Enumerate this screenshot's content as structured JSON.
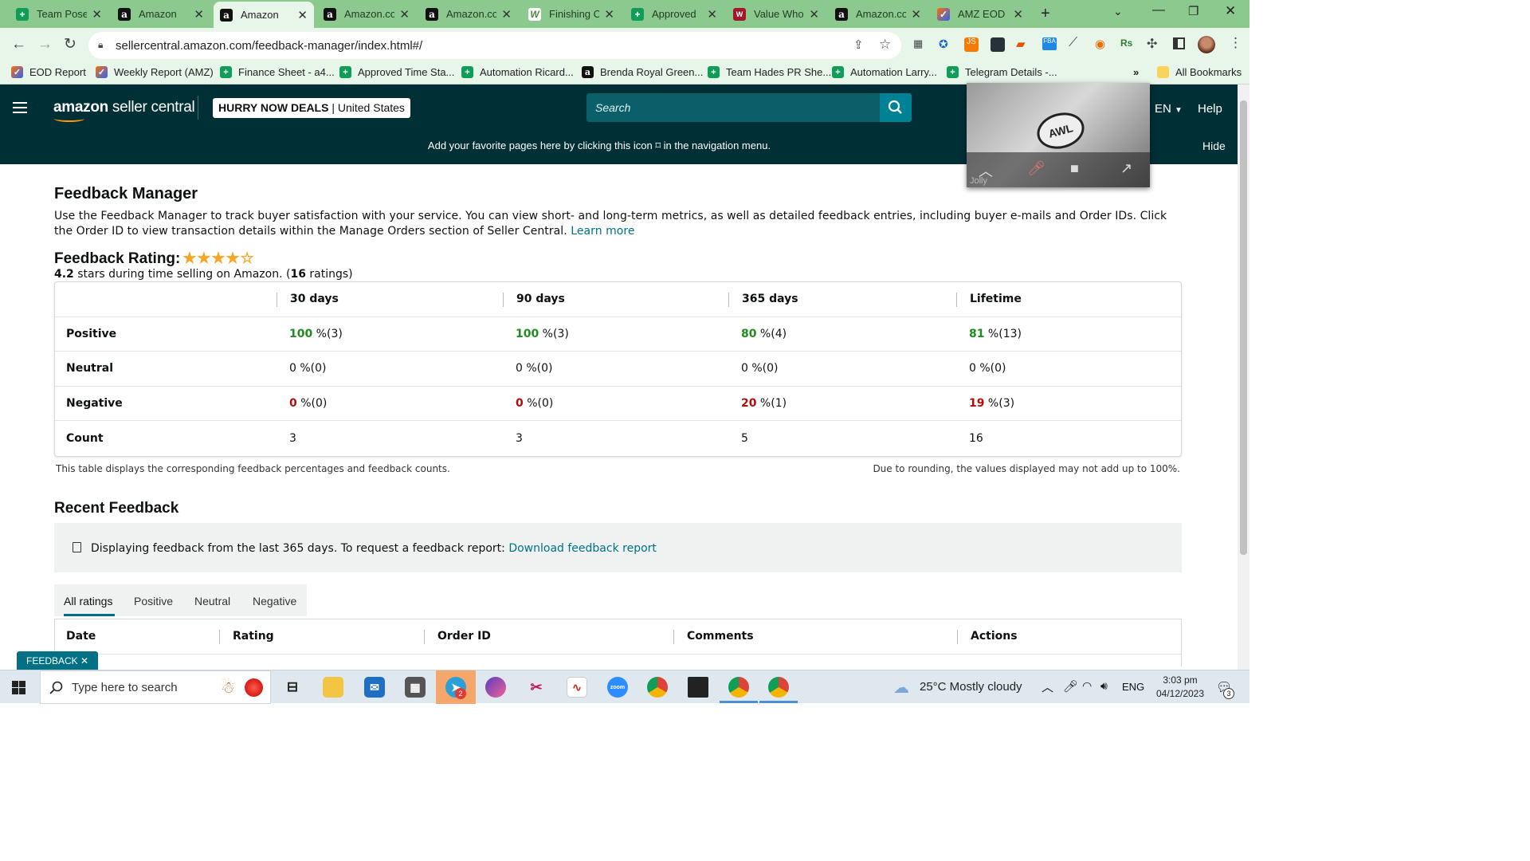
{
  "browser": {
    "tabs": [
      {
        "label": "Team Pose",
        "icon": "sheets-icon"
      },
      {
        "label": "Amazon",
        "icon": "amazon-icon"
      },
      {
        "label": "Amazon",
        "icon": "amazon-icon",
        "active": true
      },
      {
        "label": "Amazon.co",
        "icon": "amazon-icon"
      },
      {
        "label": "Amazon.co",
        "icon": "amazon-icon"
      },
      {
        "label": "Finishing C",
        "icon": "w-icon"
      },
      {
        "label": "Approved",
        "icon": "sheets-icon"
      },
      {
        "label": "Value Who",
        "icon": "value-icon"
      },
      {
        "label": "Amazon.co",
        "icon": "amazon-icon"
      },
      {
        "label": "AMZ EOD",
        "icon": "clickup-icon"
      }
    ],
    "url": "sellercentral.amazon.com/feedback-manager/index.html#/",
    "bookmarks": [
      {
        "label": "EOD Report"
      },
      {
        "label": "Weekly Report (AMZ)"
      },
      {
        "label": "Finance Sheet - a4..."
      },
      {
        "label": "Approved Time Sta..."
      },
      {
        "label": "Automation Ricard..."
      },
      {
        "label": "Brenda Royal Green..."
      },
      {
        "label": "Team Hades PR She..."
      },
      {
        "label": "Automation Larry..."
      },
      {
        "label": "Telegram Details -..."
      }
    ],
    "all_bookmarks": "All Bookmarks",
    "more": "»"
  },
  "header": {
    "logo_a": "amazon",
    "logo_b": " seller central",
    "store_name": "HURRY NOW DEALS",
    "store_region": " | United States",
    "search_placeholder": "Search",
    "lang": "EN",
    "help": "Help",
    "notice": "Add your favorite pages here by clicking this icon ⌑ in the navigation menu.",
    "hide": "Hide"
  },
  "video": {
    "logo_text": "AWL",
    "name": "Jolly"
  },
  "page": {
    "title": "Feedback Manager",
    "description": "Use the Feedback Manager to track buyer satisfaction with your service. You can view short- and long-term metrics, as well as detailed feedback entries, including buyer e-mails and Order IDs. Click the Order ID to view transaction details within the Manage Orders section of Seller Central.",
    "learn_more": "Learn more",
    "rating_title": "Feedback Rating:",
    "rating_stars": 4.2,
    "rating_value": "4.2",
    "rating_mid": " stars during time selling on Amazon. (",
    "rating_count": "16",
    "rating_end": " ratings)",
    "table": {
      "columns": [
        "30 days",
        "90 days",
        "365 days",
        "Lifetime"
      ],
      "rows": [
        {
          "label": "Positive",
          "cells": [
            [
              "100",
              " %(3)"
            ],
            [
              "100",
              " %(3)"
            ],
            [
              "80",
              " %(4)"
            ],
            [
              "81",
              " %(13)"
            ]
          ]
        },
        {
          "label": "Neutral",
          "cells": [
            [
              "0",
              " %(0)"
            ],
            [
              "0",
              " %(0)"
            ],
            [
              "0",
              " %(0)"
            ],
            [
              "0",
              " %(0)"
            ]
          ]
        },
        {
          "label": "Negative",
          "cells": [
            [
              "0",
              " %(0)"
            ],
            [
              "0",
              " %(0)"
            ],
            [
              "20",
              " %(1)"
            ],
            [
              "19",
              " %(3)"
            ]
          ]
        },
        {
          "label": "Count",
          "cells": [
            [
              "3",
              ""
            ],
            [
              "3",
              ""
            ],
            [
              "5",
              ""
            ],
            [
              "16",
              ""
            ]
          ]
        }
      ]
    },
    "note_left": "This table displays the corresponding feedback percentages and feedback counts.",
    "note_right": "Due to rounding, the values displayed may not add up to 100%.",
    "recent_title": "Recent Feedback",
    "info_text": "Displaying feedback from the last 365 days. To request a feedback report: ",
    "info_link": "Download feedback report",
    "filter_tabs": [
      "All ratings",
      "Positive",
      "Neutral",
      "Negative"
    ],
    "feedback_columns": [
      "Date",
      "Rating",
      "Order ID",
      "Comments",
      "Actions"
    ],
    "feedback_pill": "FEEDBACK ✕"
  },
  "taskbar": {
    "search_placeholder": "Type here to search",
    "weather": "25°C  Mostly cloudy",
    "lang": "ENG",
    "time": "3:03 pm",
    "date": "04/12/2023",
    "notif_count": "3"
  }
}
